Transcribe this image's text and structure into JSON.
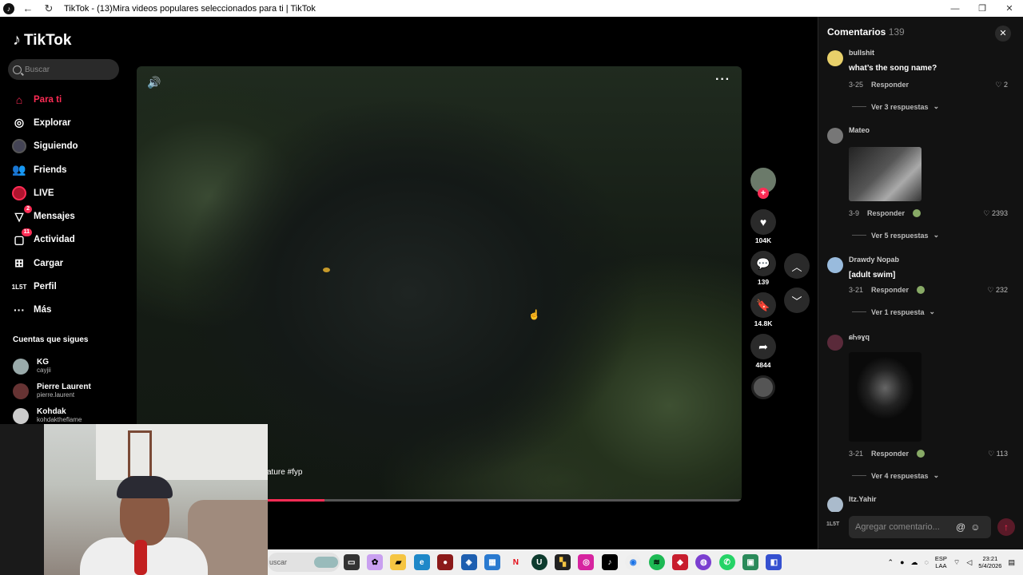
{
  "browser": {
    "title": "TikTok - (13)Mira videos populares seleccionados para ti | TikTok",
    "back_icon": "arrow-left-icon",
    "reload_icon": "reload-icon",
    "controls": [
      "—",
      "❐",
      "✕"
    ]
  },
  "sidebar": {
    "logo": "TikTok",
    "search_placeholder": "Buscar",
    "nav": [
      {
        "label": "Para ti",
        "icon": "home-icon",
        "active": true
      },
      {
        "label": "Explorar",
        "icon": "compass-icon"
      },
      {
        "label": "Siguiendo",
        "icon": "following-avatar-icon"
      },
      {
        "label": "Friends",
        "icon": "friends-icon"
      },
      {
        "label": "LIVE",
        "icon": "live-icon"
      },
      {
        "label": "Mensajes",
        "icon": "messages-icon",
        "badge": "2"
      },
      {
        "label": "Actividad",
        "icon": "activity-icon",
        "badge": "11"
      },
      {
        "label": "Cargar",
        "icon": "upload-icon"
      },
      {
        "label": "Perfil",
        "icon": "profile-icon"
      },
      {
        "label": "Más",
        "icon": "more-icon"
      }
    ],
    "following_title": "Cuentas que sigues",
    "following": [
      {
        "name": "KG",
        "handle": "cayjii"
      },
      {
        "name": "Pierre Laurent",
        "handle": "pierre.laurent"
      },
      {
        "name": "Kohdak",
        "handle": "kohdaktheflame"
      }
    ]
  },
  "video": {
    "caption": "ature #fyp",
    "progress": 0.31
  },
  "actions": {
    "likes": "104K",
    "comments": "139",
    "saves": "14.8K",
    "shares": "4844"
  },
  "comments": {
    "title": "Comentarios",
    "count": "139",
    "items": [
      {
        "user": "bullshit",
        "text": "what’s the song name?",
        "date": "3-25",
        "reply": "Responder",
        "likes": "2",
        "more": "Ver 3 respuestas"
      },
      {
        "user": "Mateo",
        "text": "",
        "date": "3-9",
        "reply": "Responder",
        "likes": "2393",
        "more": "Ver 5 respuestas"
      },
      {
        "user": "Drawdy Nopab",
        "text": "[adult swim]",
        "date": "3-21",
        "reply": "Responder",
        "likes": "232",
        "more": "Ver 1 respuesta"
      },
      {
        "user": "ɕᏂɘɣq",
        "text": "",
        "date": "3-21",
        "reply": "Responder",
        "likes": "113",
        "more": "Ver 4 respuestas"
      },
      {
        "user": "Itz.Yahir",
        "text": "",
        "date": "",
        "reply": "",
        "likes": "",
        "more": ""
      }
    ],
    "input_placeholder": "Agregar comentario...",
    "me_label": "1L5T"
  },
  "taskbar": {
    "search_text": "uscar",
    "lang_top": "ESP",
    "lang_bottom": "LAA",
    "time": "23:21",
    "date": "5/4/2026"
  },
  "colors": {
    "accent": "#fe2c55",
    "background": "#000000",
    "panel": "#121212"
  }
}
